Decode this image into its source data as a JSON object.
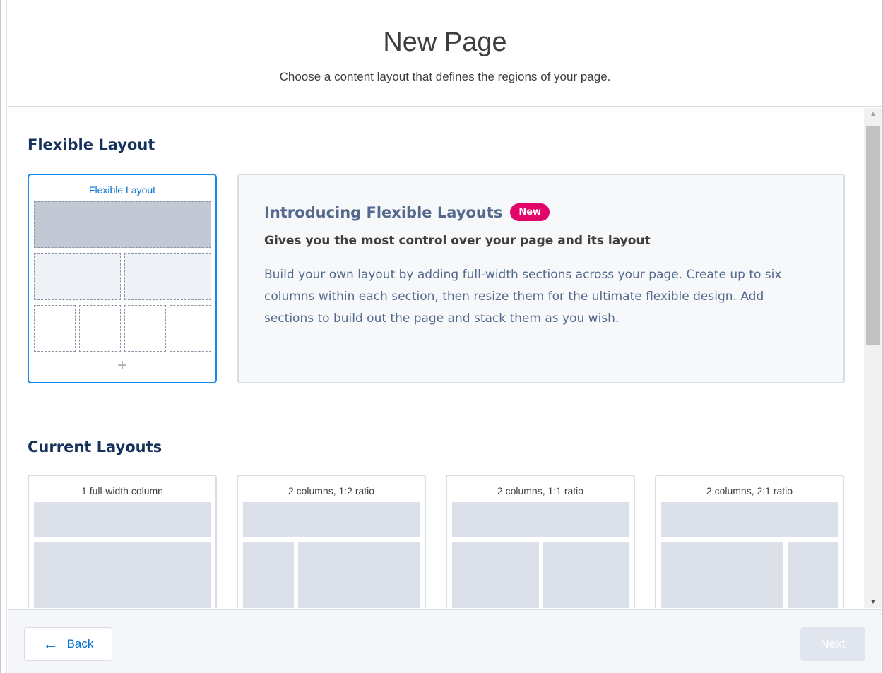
{
  "header": {
    "title": "New Page",
    "subtitle": "Choose a content layout that defines the regions of your page."
  },
  "flexible": {
    "section_title": "Flexible Layout",
    "card_label": "Flexible Layout",
    "intro_title": "Introducing Flexible Layouts",
    "badge": "New",
    "intro_subtitle": "Gives you the most control over your page and its layout",
    "intro_body": "Build your own layout by adding full-width sections across your page. Create up to six columns within each section, then resize them for the ultimate flexible design. Add sections to build out the page and stack them as you wish.",
    "plus": "+"
  },
  "current": {
    "section_title": "Current Layouts",
    "layouts": [
      {
        "label": "1 full-width column"
      },
      {
        "label": "2 columns, 1:2 ratio"
      },
      {
        "label": "2 columns, 1:1 ratio"
      },
      {
        "label": "2 columns, 2:1 ratio"
      }
    ]
  },
  "footer": {
    "back_label": "Back",
    "next_label": "Next"
  },
  "colors": {
    "accent": "#0070d2",
    "badge": "#e3066a",
    "selected_border": "#1589ee"
  }
}
